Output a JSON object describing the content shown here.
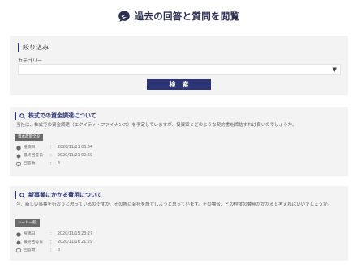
{
  "header": {
    "title": "過去の回答と質問を閲覧"
  },
  "filter": {
    "title": "絞り込み",
    "category_label": "カテゴリー",
    "category_value": "",
    "search_button": "検索"
  },
  "sep": "：",
  "posts": [
    {
      "title": "株式での資金調達について",
      "excerpt": "当社は、株式での資金調達（エクイティ・ファイナンス）を予定していますが、投資家とどのような契約書を締結すれば良いのでしょうか。",
      "tag": "資本政策全般",
      "meta": [
        {
          "label": "投稿日",
          "value": "2020/11/21 03:54"
        },
        {
          "label": "最終回答日",
          "value": "2020/11/21 02:59"
        },
        {
          "label": "回答数",
          "value": "4"
        }
      ]
    },
    {
      "title": "新事業にかかる費用について",
      "excerpt": "今、新しい事業を行おうと思っているのですが、その際に会社を設立しようと思っています。その場合、どの程度の費用がかかると考えればいいでしょうか。",
      "tag": "シード一般",
      "meta": [
        {
          "label": "投稿日",
          "value": "2020/11/15 23:27"
        },
        {
          "label": "最終回答日",
          "value": "2020/11/16 21:29"
        },
        {
          "label": "回答数",
          "value": "8"
        }
      ]
    }
  ],
  "colors": {
    "accent": "#2b3576",
    "card_bg": "#f3f3f3",
    "tag_bg": "#6a6a6a"
  }
}
